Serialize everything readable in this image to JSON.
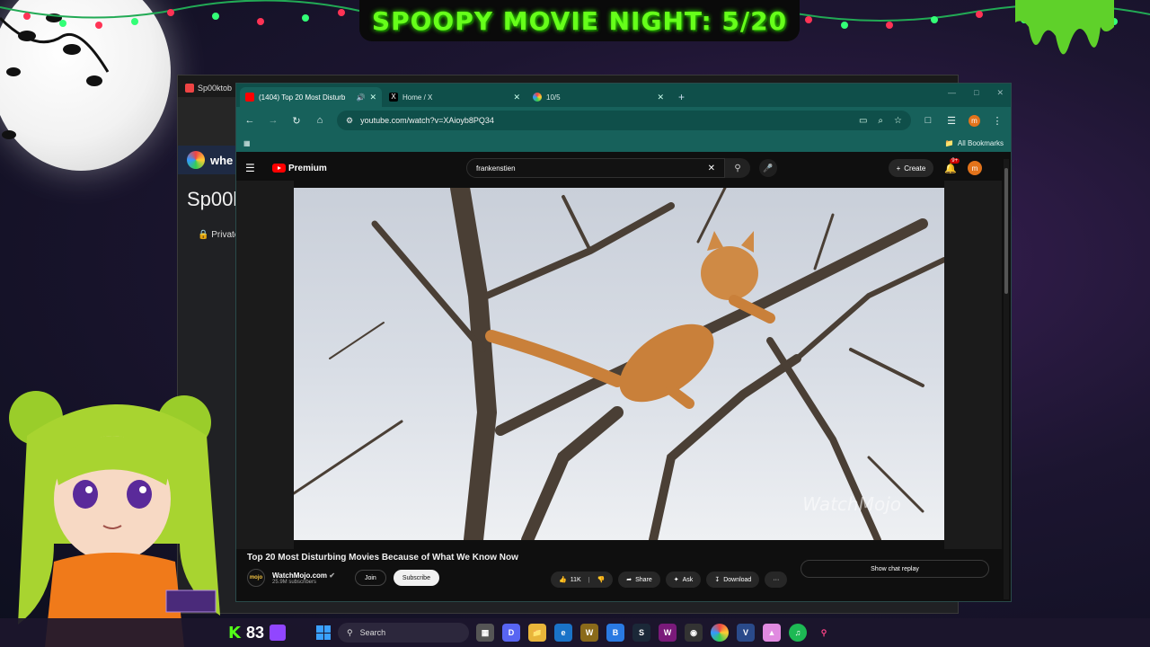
{
  "overlay": {
    "banner": "SPOOPY MOVIE NIGHT: 5/20"
  },
  "back_window": {
    "tab_label": "Sp00ktob",
    "site_fragment": "whe",
    "title_fragment": "Sp00k",
    "private_label": "Private"
  },
  "browser": {
    "tabs": [
      {
        "label": "(1404) Top 20 Most Disturb",
        "active": true
      },
      {
        "label": "Home / X",
        "active": false
      },
      {
        "label": "10/5",
        "active": false
      }
    ],
    "new_tab": "+",
    "url": "youtube.com/watch?v=XAioyb8PQ34",
    "bookmarks_label": "All Bookmarks",
    "profile_initial": "m"
  },
  "youtube": {
    "logo_label": "Premium",
    "search_value": "frankenstien",
    "create_label": "Create",
    "notif_badge": "9+",
    "avatar_initial": "m",
    "video": {
      "title": "Top 20 Most Disturbing Movies Because of What We Know Now",
      "watermark": "WatchMojo"
    },
    "channel": {
      "name": "WatchMojo.com",
      "subscribers": "25.9M subscribers",
      "avatar_text": "mojo"
    },
    "join_label": "Join",
    "subscribe_label": "Subscribe",
    "likes": "11K",
    "share_label": "Share",
    "ask_label": "Ask",
    "download_label": "Download",
    "more_label": "···",
    "chat_replay_label": "Show chat replay"
  },
  "taskbar": {
    "kick_label": "K",
    "count": "83",
    "search_placeholder": "Search"
  },
  "colors": {
    "banner_text": "#66ff1a",
    "chrome_tab": "#0f4f4a",
    "chrome_toolbar": "#17615b",
    "youtube_red": "#ff0000",
    "profile": "#e2731b"
  }
}
